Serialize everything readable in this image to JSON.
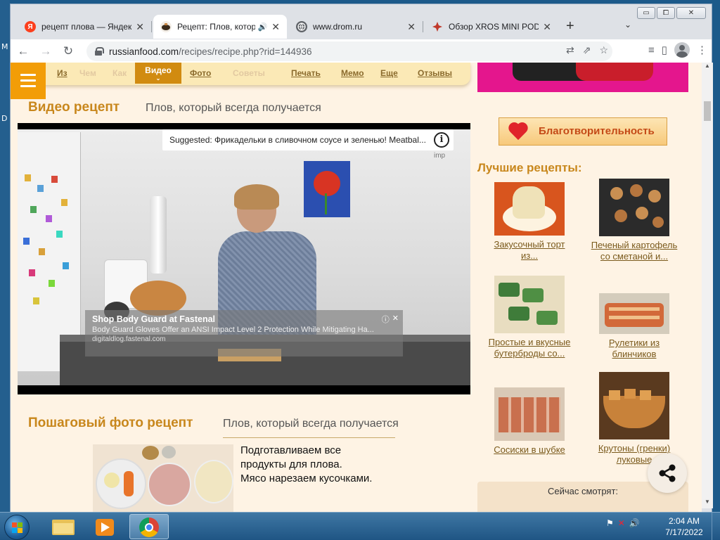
{
  "desktop": {
    "left_glyphs": [
      "M",
      "D"
    ]
  },
  "window": {
    "controls": {
      "minimize": "▭",
      "maximize": "⧠",
      "close": "✕"
    }
  },
  "tabs": [
    {
      "title": "рецепт плова — Яндекс",
      "favicon": "yandex-icon",
      "favicon_text": "Я",
      "favicon_color": "#fc3f1d"
    },
    {
      "title": "Рецепт: Плов, который всегда получается",
      "favicon": "pot-icon",
      "audio": "🔊"
    },
    {
      "title": "www.drom.ru",
      "favicon": "globe-icon"
    },
    {
      "title": "Обзор XROS MINI POD",
      "favicon": "xros-icon"
    }
  ],
  "tab_close": "✕",
  "newtab": "+",
  "tab_search": "⌄",
  "toolbar": {
    "back": "←",
    "forward": "→",
    "reload": "↻",
    "url_host": "russianfood.com",
    "url_path": "/recipes/recipe.php?rid=144936",
    "translate_icon": "⇄",
    "share_icon": "⇗",
    "star_icon": "☆",
    "media_icon": "≡",
    "sidepanel_icon": "▯",
    "menu_icon": "⋮"
  },
  "site_menu": {
    "items": [
      {
        "label": "Из",
        "state": "link"
      },
      {
        "label": "Чем",
        "state": "faded"
      },
      {
        "label": "Как",
        "state": "faded"
      },
      {
        "label": "Видео",
        "state": "active",
        "arrow": "⌄"
      },
      {
        "label": "Фото",
        "state": "link"
      },
      {
        "label": "Советы",
        "state": "faded"
      },
      {
        "label": "Печать",
        "state": "link"
      },
      {
        "label": "Мемо",
        "state": "link"
      },
      {
        "label": "Еще",
        "state": "link"
      },
      {
        "label": "Отзывы",
        "state": "link"
      }
    ]
  },
  "video_section": {
    "heading": "Видео рецепт",
    "subtitle": "Плов, который всегда получается",
    "suggested": "Suggested: Фрикадельки в сливочном соусе и зеленью! Meatbal...",
    "info_glyph": "i",
    "imp_label": "imp",
    "ad": {
      "title": "Shop Body Guard at Fastenal",
      "desc": "Body Guard Gloves Offer an ANSI Impact Level 2 Protection While Mitigating Ha...",
      "url": "digitaldlog.fastenal.com",
      "info_glyph": "ⓘ",
      "close_glyph": "✕"
    }
  },
  "photo_section": {
    "heading": "Пошаговый фото рецепт",
    "subtitle": "Плов, который всегда получается",
    "step_lines": [
      "Подготавливаем все",
      "продукты для плова.",
      "Мясо нарезаем кусочками."
    ]
  },
  "sidebar": {
    "charity_label": "Благотворительность",
    "best_heading": "Лучшие рецепты:",
    "recipes": [
      {
        "caption": [
          "Закусочный торт",
          "из..."
        ]
      },
      {
        "caption": [
          "Печеный картофель",
          "со сметаной и..."
        ]
      },
      {
        "caption": [
          "Простые и вкусные",
          "бутерброды со..."
        ]
      },
      {
        "caption": [
          "Рулетики из",
          "блинчиков"
        ]
      },
      {
        "caption": [
          "Сосиски в шубке"
        ]
      },
      {
        "caption": [
          "Крутоны (гренки)",
          "луковые"
        ]
      }
    ],
    "now_watching": "Сейчас смотрят:"
  },
  "taskbar": {
    "apps": [
      "explorer-icon",
      "media-player-icon",
      "chrome-icon"
    ],
    "tray": [
      "⚑",
      "✕",
      "🔊"
    ],
    "time": "2:04 AM",
    "date": "7/17/2022"
  },
  "colors": {
    "accent_orange": "#f29d07",
    "heading_gold": "#c8871c",
    "page_bg": "#fef3e4",
    "menu_bg": "#fbe9b6"
  }
}
